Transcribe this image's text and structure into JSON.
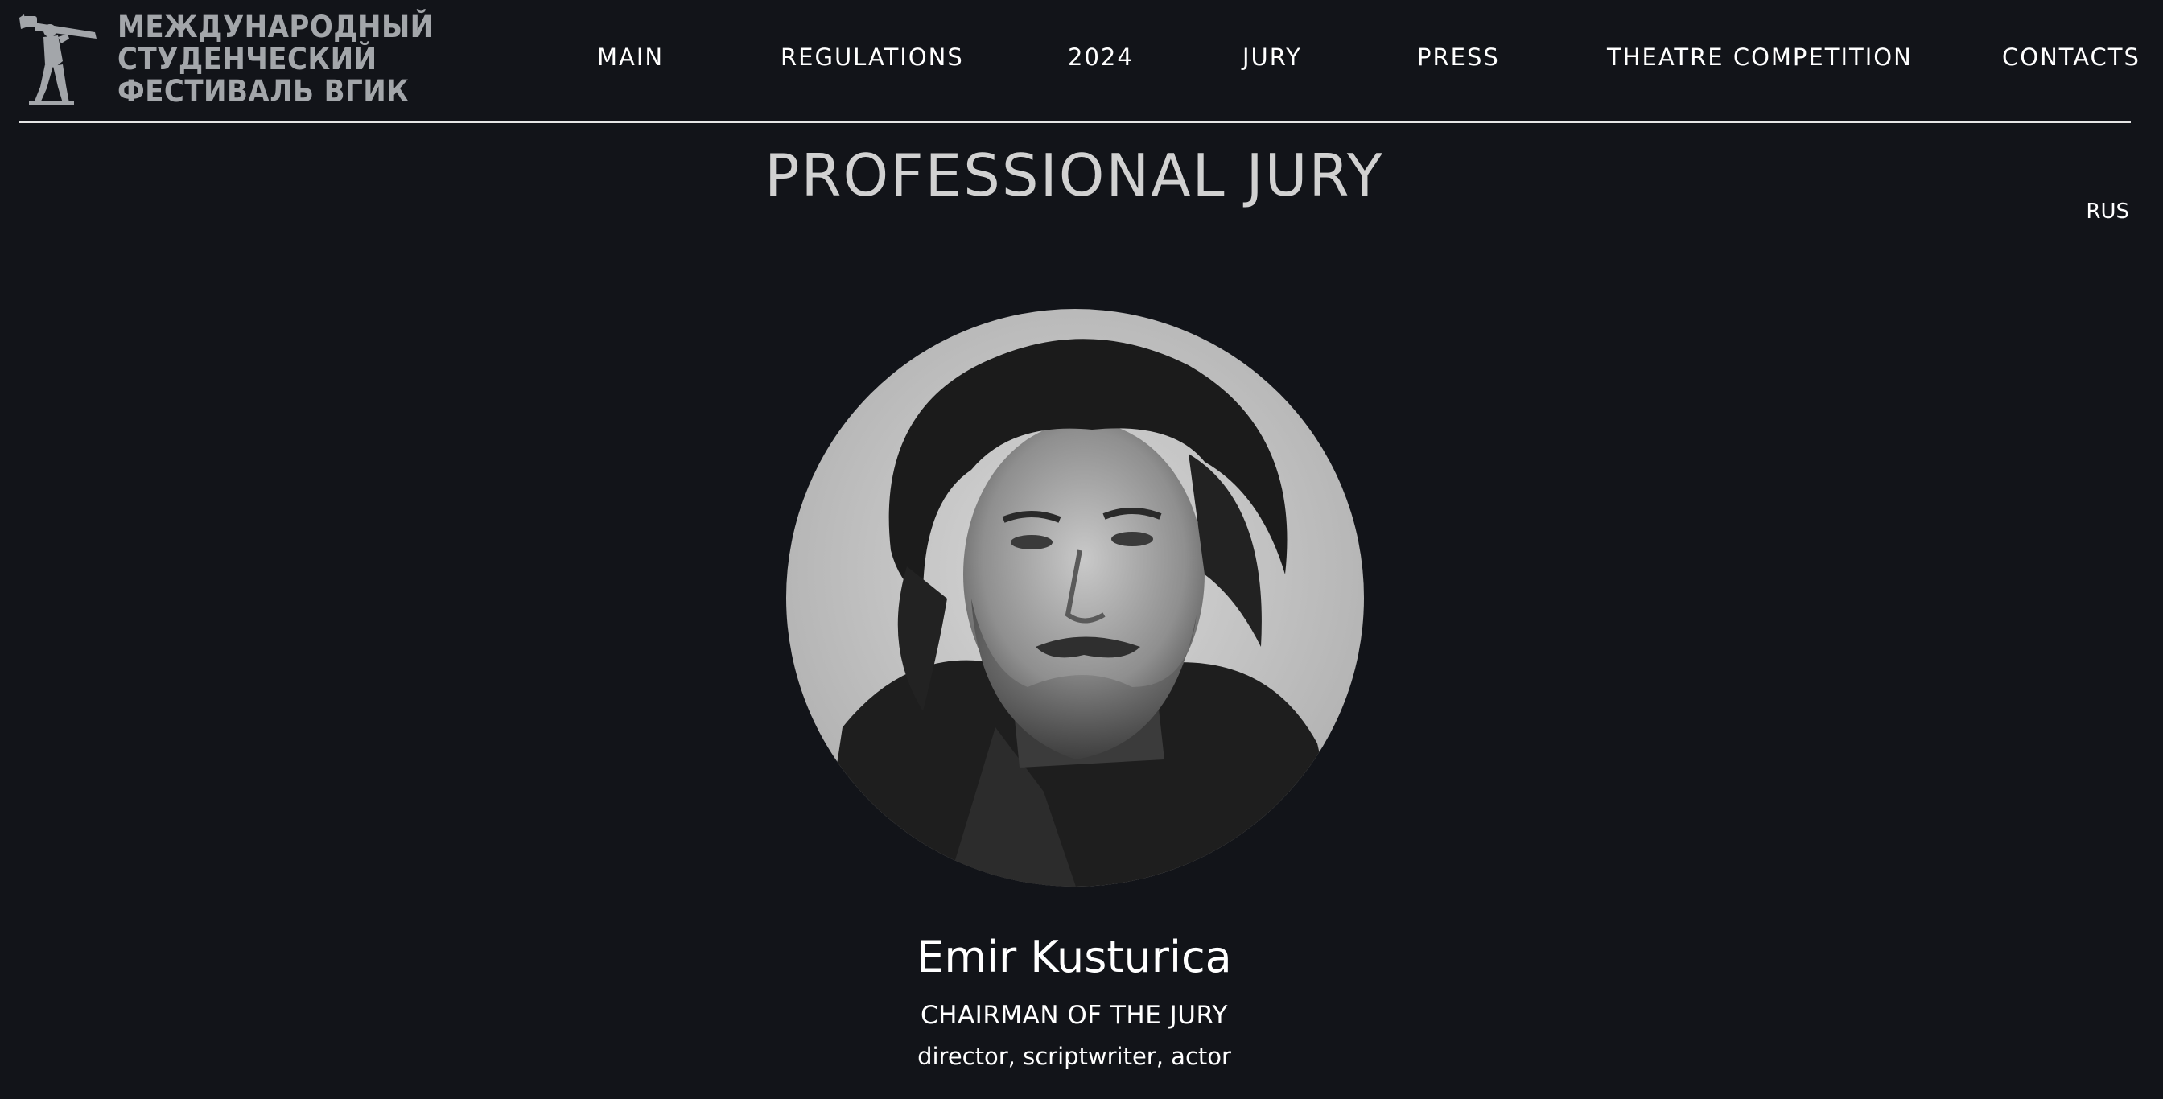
{
  "logo": {
    "icon": "statue-icon",
    "lines": [
      "МЕЖДУНАРОДНЫЙ",
      "СТУДЕНЧЕСКИЙ",
      "ФЕСТИВАЛЬ ВГИК"
    ]
  },
  "nav": {
    "items": [
      {
        "label": "MAIN"
      },
      {
        "label": "REGULATIONS"
      },
      {
        "label": "2024"
      },
      {
        "label": "JURY"
      },
      {
        "label": "PRESS"
      },
      {
        "label": "THEATRE COMPETITION"
      },
      {
        "label": "CONTACTS"
      }
    ]
  },
  "page": {
    "title": "PROFESSIONAL JURY",
    "language_switch": "RUS"
  },
  "jury_member": {
    "name": "Emir Kusturica",
    "role": "CHAIRMAN OF THE JURY",
    "profession": "director, scriptwriter, actor"
  },
  "colors": {
    "background": "#121419",
    "text": "#ffffff",
    "title": "#d1d1d1",
    "logo": "#a3a6aa"
  }
}
